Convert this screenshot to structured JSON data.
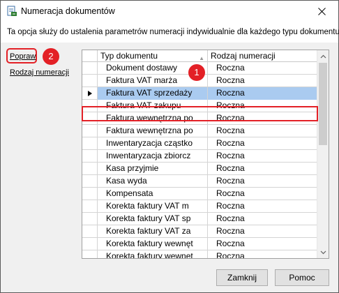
{
  "window": {
    "title": "Numeracja dokumentów",
    "close_glyph": "✕",
    "app_icon": "document-numbering-icon"
  },
  "description": "Ta opcja służy do ustalenia parametrów numeracji indywidualnie dla każdego typu dokumentu.",
  "sidebar": {
    "popraw_label": "Popraw",
    "rodzaj_label": "Rodzaj numeracji"
  },
  "annotations": {
    "badge_1": "1",
    "badge_2": "2",
    "accent_color": "#e32026"
  },
  "grid": {
    "columns": [
      "Typ dokumentu",
      "Rodzaj numeracji"
    ],
    "sort_glyph": "▲",
    "selected_index": 2,
    "selection_color": "#aacbf0",
    "rows": [
      {
        "typ": "Dokument dostawy",
        "rodzaj": "Roczna"
      },
      {
        "typ": "Faktura VAT marża",
        "rodzaj": "Roczna"
      },
      {
        "typ": "Faktura VAT sprzedaży",
        "rodzaj": "Roczna"
      },
      {
        "typ": "Faktura VAT zakupu",
        "rodzaj": "Roczna"
      },
      {
        "typ": "Faktura wewnętrzna po",
        "rodzaj": "Roczna"
      },
      {
        "typ": "Faktura wewnętrzna po",
        "rodzaj": "Roczna"
      },
      {
        "typ": "Inwentaryzacja cząstko",
        "rodzaj": "Roczna"
      },
      {
        "typ": "Inwentaryzacja zbiorcz",
        "rodzaj": "Roczna"
      },
      {
        "typ": "Kasa przyjmie",
        "rodzaj": "Roczna"
      },
      {
        "typ": "Kasa wyda",
        "rodzaj": "Roczna"
      },
      {
        "typ": "Kompensata",
        "rodzaj": "Roczna"
      },
      {
        "typ": "Korekta faktury VAT m",
        "rodzaj": "Roczna"
      },
      {
        "typ": "Korekta faktury VAT sp",
        "rodzaj": "Roczna"
      },
      {
        "typ": "Korekta faktury VAT za",
        "rodzaj": "Roczna"
      },
      {
        "typ": "Korekta faktury wewnęt",
        "rodzaj": "Roczna"
      },
      {
        "typ": "Korekta faktury wewnęt",
        "rodzaj": "Roczna"
      }
    ]
  },
  "buttons": {
    "close_label": "Zamknij",
    "help_label": "Pomoc"
  }
}
